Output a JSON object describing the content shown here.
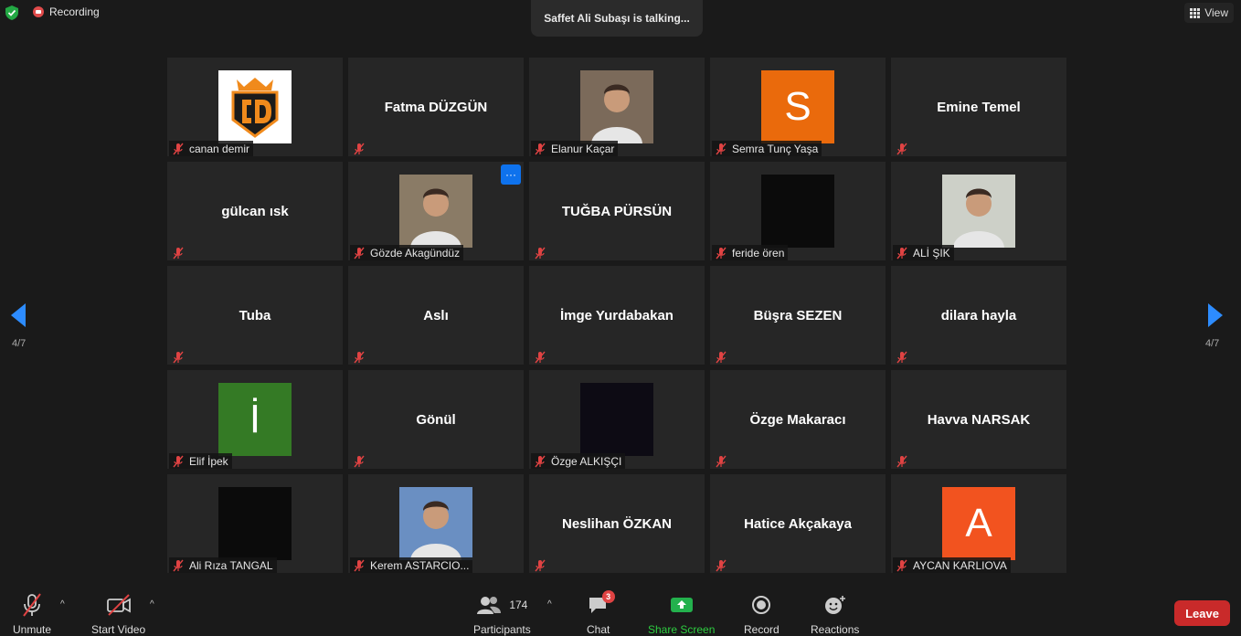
{
  "top": {
    "recording_label": "Recording",
    "talking": "Saffet Ali Subaşı is talking...",
    "view_label": "View"
  },
  "pagination": {
    "left": "4/7",
    "right": "4/7"
  },
  "tiles": [
    {
      "name": "canan demir",
      "show_big": false,
      "pic": "logo"
    },
    {
      "name": "",
      "big": "Fatma DÜZGÜN",
      "show_big": true
    },
    {
      "name": "Elanur Kaçar",
      "show_big": false,
      "pic": "photo"
    },
    {
      "name": "Semra Tunç Yaşa",
      "show_big": false,
      "pic": "letter",
      "letter": "S",
      "color": "#ea6a0c"
    },
    {
      "name": "",
      "big": "Emine Temel",
      "show_big": true
    },
    {
      "name": "",
      "big": "gülcan ısk",
      "show_big": true
    },
    {
      "name": "Gözde Akagündüz",
      "show_big": false,
      "pic": "photo",
      "more": "···"
    },
    {
      "name": "",
      "big": "TUĞBA PÜRSÜN",
      "show_big": true
    },
    {
      "name": "feride ören",
      "show_big": false,
      "pic": "black"
    },
    {
      "name": "ALİ ŞIK",
      "show_big": false,
      "pic": "photo"
    },
    {
      "name": "",
      "big": "Tuba",
      "show_big": true
    },
    {
      "name": "",
      "big": "Aslı",
      "show_big": true
    },
    {
      "name": "",
      "big": "İmge Yurdabakan",
      "show_big": true
    },
    {
      "name": "",
      "big": "Büşra SEZEN",
      "show_big": true
    },
    {
      "name": "",
      "big": "dilara hayla",
      "show_big": true
    },
    {
      "name": "Elif İpek",
      "show_big": false,
      "pic": "letter",
      "letter": "İ",
      "color": "#347a25"
    },
    {
      "name": "",
      "big": "Gönül",
      "show_big": true
    },
    {
      "name": "Özge ALKIŞÇI",
      "show_big": false,
      "pic": "black"
    },
    {
      "name": "",
      "big": "Özge Makaracı",
      "show_big": true
    },
    {
      "name": "",
      "big": "Havva NARSAK",
      "show_big": true
    },
    {
      "name": "Ali Rıza TANGAL",
      "show_big": false,
      "pic": "black"
    },
    {
      "name": "Kerem ASTARCIO...",
      "show_big": false,
      "pic": "photo"
    },
    {
      "name": "",
      "big": "Neslihan ÖZKAN",
      "show_big": true
    },
    {
      "name": "",
      "big": "Hatice Akçakaya",
      "show_big": true
    },
    {
      "name": "AYCAN KARLIOVA",
      "show_big": false,
      "pic": "letter",
      "letter": "A",
      "color": "#f2531f"
    }
  ],
  "toolbar": {
    "unmute": "Unmute",
    "start_video": "Start Video",
    "participants_count": "174",
    "participants": "Participants",
    "chat": "Chat",
    "chat_badge": "3",
    "share_screen": "Share Screen",
    "record": "Record",
    "reactions": "Reactions",
    "leave": "Leave"
  }
}
